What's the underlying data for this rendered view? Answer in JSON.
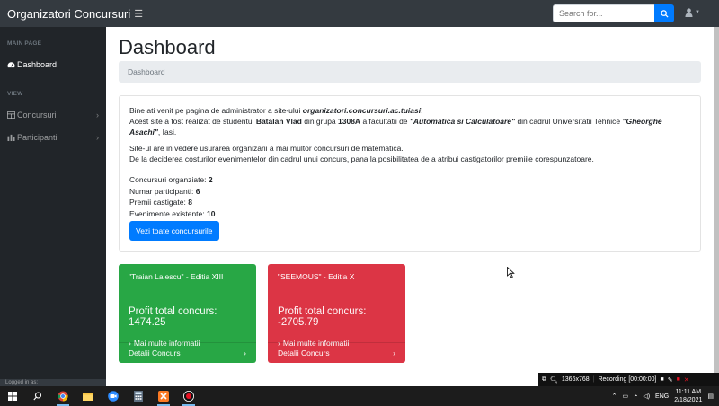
{
  "navbar": {
    "brand": "Organizatori Concursuri",
    "search_placeholder": "Search for..."
  },
  "sidebar": {
    "heading_main": "MAIN PAGE",
    "heading_view": "VIEW",
    "items": [
      {
        "label": "Dashboard",
        "icon": "tachometer-icon"
      },
      {
        "label": "Concursuri",
        "icon": "table-icon"
      },
      {
        "label": "Participanti",
        "icon": "bar-chart-icon"
      }
    ],
    "footer": "Logged in as:"
  },
  "main": {
    "title": "Dashboard",
    "breadcrumb": "Dashboard",
    "intro": {
      "l1_a": "Bine ati venit pe pagina de administrator a site-ului ",
      "l1_site": "organizatori.concursuri.ac.tuiasi",
      "l1_end": "!",
      "l2_a": "Acest site a fost realizat de studentul ",
      "l2_name": "Batalan Vlad",
      "l2_b": " din grupa ",
      "l2_group": "1308A",
      "l2_c": " a facultatii de ",
      "l2_faculty": "\"Automatica si Calculatoare\"",
      "l2_d": " din cadrul Universitatii Tehnice ",
      "l2_uni": "\"Gheorghe Asachi\"",
      "l2_e": ", Iasi.",
      "p2_l1": "Site-ul are in vedere usurarea organizarii a mai multor concursuri de matematica.",
      "p2_l2": "De la deciderea costurilor evenimentelor din cadrul unui concurs, pana la posibilitatea de a atribui castigatorilor premiile corespunzatoare."
    },
    "stats": [
      {
        "label": "Concursuri organziate: ",
        "value": "2"
      },
      {
        "label": "Numar participanti: ",
        "value": "6"
      },
      {
        "label": "Premii castigate: ",
        "value": "8"
      },
      {
        "label": "Evenimente existente: ",
        "value": "10"
      }
    ],
    "all_button": "Vezi toate concursurile",
    "cards": [
      {
        "title": "\"Traian Lalescu\" - Editia XIII",
        "profit": "Profit total concurs: 1474.25",
        "more": "Mai multe informatii",
        "footer": "Detalii Concurs",
        "color": "#28a745"
      },
      {
        "title": "\"SEEMOUS\" - Editia X",
        "profit": "Profit total concurs: -2705.79",
        "more": "Mai multe informatii",
        "footer": "Detalii Concurs",
        "color": "#dc3545"
      }
    ]
  },
  "recording_bar": {
    "resolution": "1366x768",
    "status": "Recording [00:00:00]"
  },
  "taskbar": {
    "lang": "ENG",
    "time": "11:11 AM",
    "date": "2/18/2021"
  }
}
